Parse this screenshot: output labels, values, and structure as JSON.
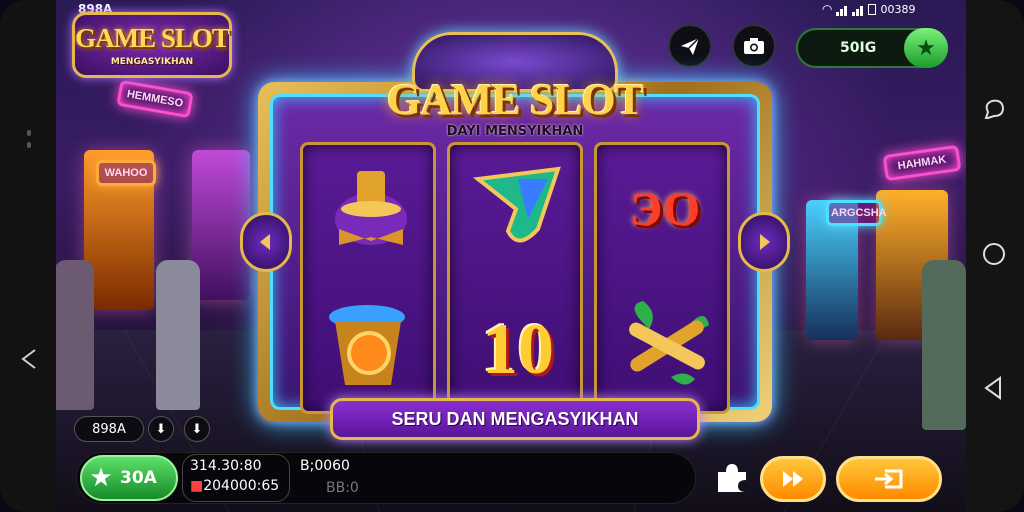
{
  "status_bar": {
    "left_text": "898A",
    "right_text": "00389"
  },
  "logo": {
    "title": "GAME SLOT",
    "subtitle": "MENGASYIKHAN"
  },
  "balance": {
    "amount": "50IG"
  },
  "slot": {
    "title": "GAME SLOT",
    "subtitle": "DAYI MENSYIKHAN",
    "banner": "SERU DAN MENGASYIKHAN",
    "symbols": [
      "top-hat-bowtie",
      "green-feather",
      "red-number-badge",
      "golden-bucket",
      "number-10",
      "golden-bamboo-leaves"
    ],
    "symbol_badge_text": "ЭО",
    "number_symbol": "10"
  },
  "neon_signs": [
    "HEMMESO",
    "WAHOO",
    "HAHMAK",
    "ARGCSHA"
  ],
  "bottom": {
    "chip_label": "898A",
    "chip_down": "⬇",
    "chip_up": "⬇",
    "green_button_value": "30A",
    "stat_line1": "314.30:80",
    "stat_line2": "204000:65",
    "stat_line3": "B;0060",
    "stat_line4": "BB:0"
  },
  "colors": {
    "accent_gold": "#e5b84a",
    "neon_blue": "#4fe0ff",
    "green": "#1c9c2c",
    "orange": "#ff8a00"
  }
}
